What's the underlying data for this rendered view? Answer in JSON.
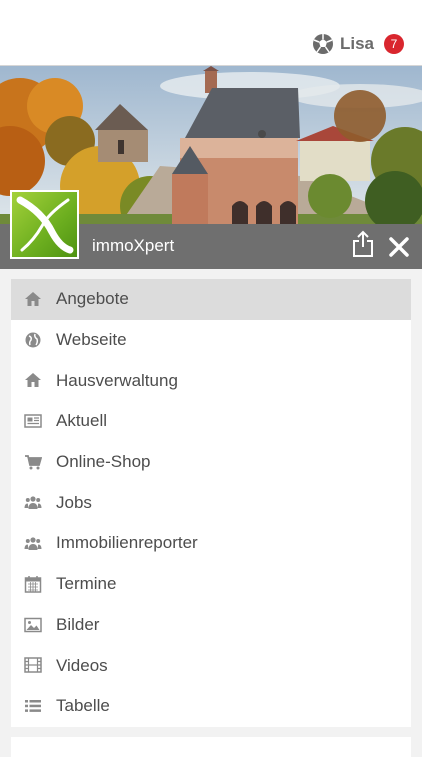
{
  "topbar": {
    "user_icon": "soccer-ball-icon",
    "user_name": "Lisa",
    "notification_count": "7",
    "badge_color": "#d9262e"
  },
  "header": {
    "logo_icon": "immoxpert-x-logo",
    "title": "immoXpert",
    "share_icon": "share-icon",
    "close_icon": "close-icon",
    "bar_color": "#6f6f6f"
  },
  "menu": {
    "items": [
      {
        "label": "Angebote",
        "icon": "home-icon",
        "active": true
      },
      {
        "label": "Webseite",
        "icon": "globe-icon",
        "active": false
      },
      {
        "label": "Hausverwaltung",
        "icon": "home-icon",
        "active": false
      },
      {
        "label": "Aktuell",
        "icon": "newspaper-icon",
        "active": false
      },
      {
        "label": "Online-Shop",
        "icon": "cart-icon",
        "active": false
      },
      {
        "label": "Jobs",
        "icon": "users-icon",
        "active": false
      },
      {
        "label": "Immobilienreporter",
        "icon": "users-icon",
        "active": false
      },
      {
        "label": "Termine",
        "icon": "calendar-icon",
        "active": false
      },
      {
        "label": "Bilder",
        "icon": "image-icon",
        "active": false
      },
      {
        "label": "Videos",
        "icon": "film-icon",
        "active": false
      },
      {
        "label": "Tabelle",
        "icon": "list-icon",
        "active": false
      }
    ]
  }
}
